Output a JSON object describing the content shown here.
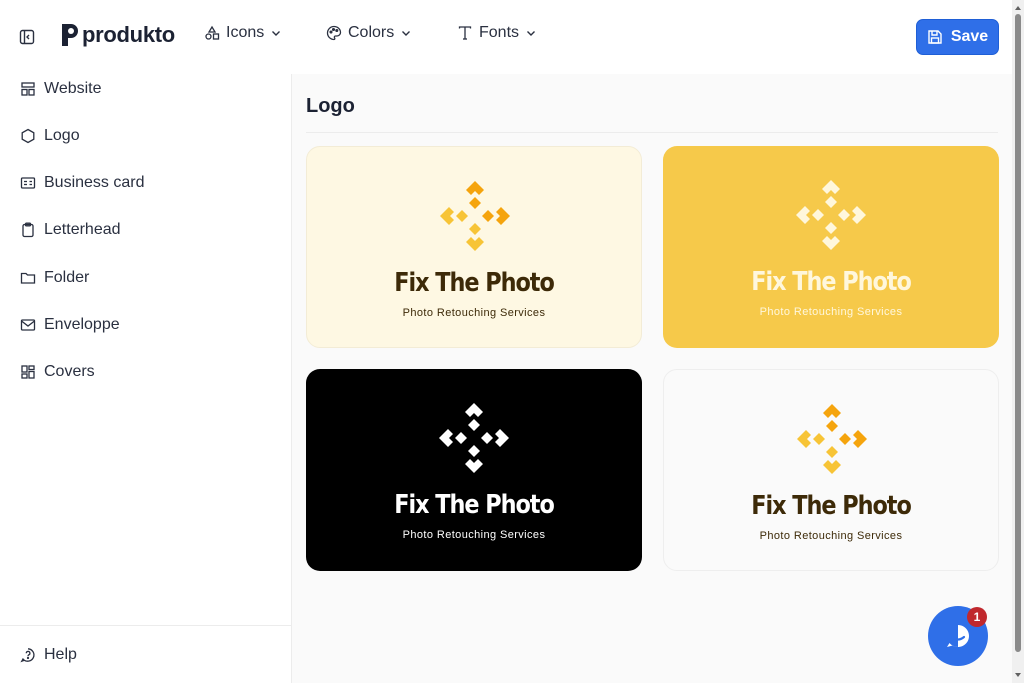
{
  "header": {
    "brand": "produkto",
    "menus": [
      {
        "label": "Icons",
        "icon": "shapes-icon"
      },
      {
        "label": "Colors",
        "icon": "palette-icon"
      },
      {
        "label": "Fonts",
        "icon": "type-icon"
      }
    ],
    "save_label": "Save"
  },
  "sidebar": {
    "items": [
      {
        "label": "Website",
        "icon": "layout-icon"
      },
      {
        "label": "Logo",
        "icon": "hexagon-icon"
      },
      {
        "label": "Business card",
        "icon": "id-card-icon"
      },
      {
        "label": "Letterhead",
        "icon": "clipboard-icon"
      },
      {
        "label": "Folder",
        "icon": "folder-icon"
      },
      {
        "label": "Enveloppe",
        "icon": "mail-icon"
      },
      {
        "label": "Covers",
        "icon": "grid-icon"
      }
    ],
    "help_label": "Help"
  },
  "main": {
    "title": "Logo",
    "cards": [
      {
        "name": "Fix The Photo",
        "tagline": "Photo Retouching Services",
        "bg": "#fef8e3",
        "text": "#3d2a08",
        "mark_a": "#f5a40d",
        "mark_b": "#f7c436"
      },
      {
        "name": "Fix The Photo",
        "tagline": "Photo Retouching Services",
        "bg": "#f6c94a",
        "text": "#fff7dc",
        "mark_a": "#fff7dc",
        "mark_b": "#fff7dc"
      },
      {
        "name": "Fix The Photo",
        "tagline": "Photo Retouching Services",
        "bg": "#000000",
        "text": "#ffffff",
        "mark_a": "#ffffff",
        "mark_b": "#ffffff"
      },
      {
        "name": "Fix The Photo",
        "tagline": "Photo Retouching Services",
        "bg": "#fafafa",
        "text": "#3d2a08",
        "mark_a": "#f5a40d",
        "mark_b": "#f7c436"
      }
    ]
  },
  "chat": {
    "badge_count": "1"
  },
  "colors": {
    "accent": "#2f6fe8",
    "badge": "#c0282d"
  }
}
